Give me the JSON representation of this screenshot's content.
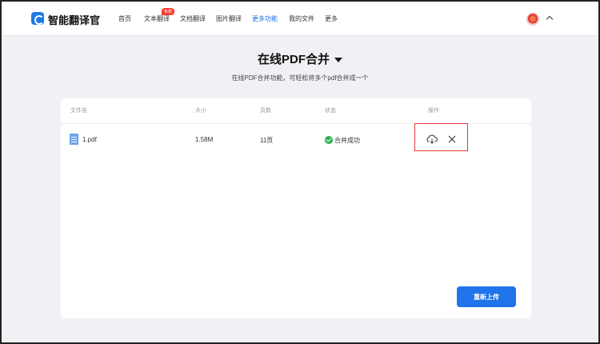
{
  "app": {
    "name": "智能翻译官"
  },
  "nav": {
    "items": [
      {
        "label": "首页"
      },
      {
        "label": "文本翻译",
        "badge": "免费"
      },
      {
        "label": "文档翻译"
      },
      {
        "label": "图片翻译"
      },
      {
        "label": "更多功能",
        "active": true
      },
      {
        "label": "我的文件"
      },
      {
        "label": "更多"
      }
    ]
  },
  "page": {
    "title": "在线PDF合并",
    "subtitle": "在线PDF合并功能，可轻松将多个pdf合并成一个"
  },
  "table": {
    "headers": [
      "文件名",
      "大小",
      "页数",
      "状态",
      "操作"
    ],
    "rows": [
      {
        "name": "1.pdf",
        "size": "1.58M",
        "pages": "11页",
        "status": "合并成功"
      }
    ]
  },
  "icons": {
    "download": "cloud-download-icon",
    "close": "close-icon",
    "status": "check-circle-icon",
    "file": "file-icon"
  },
  "buttons": {
    "reupload": "重新上传"
  },
  "colors": {
    "accent": "#1f74ec",
    "success": "#2bb24c",
    "highlight": "#e53935"
  }
}
